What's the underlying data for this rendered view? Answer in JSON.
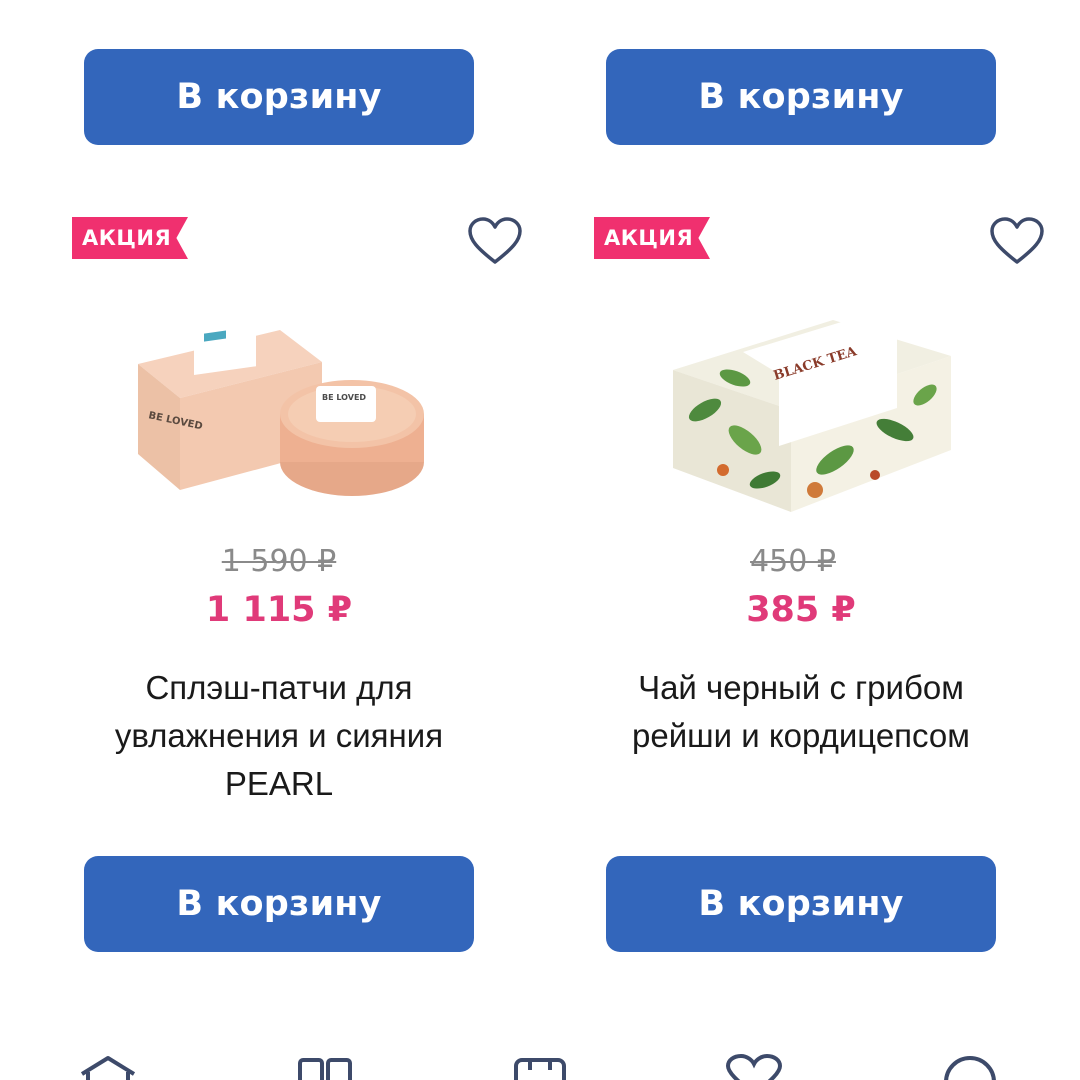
{
  "colors": {
    "button": "#3366bb",
    "badge": "#f0306f",
    "sale_price": "#e03a79",
    "icon_stroke": "#3d4a6a"
  },
  "top_row": {
    "left_button": "В корзину",
    "right_button": "В корзину"
  },
  "products": [
    {
      "badge": "АКЦИЯ",
      "image_label": "BE LOVED",
      "old_price": "1 590 ₽",
      "price": "1 115 ₽",
      "title_lines": [
        "Сплэш-патчи для",
        "увлажнения и сияния",
        "PEARL"
      ],
      "button": "В корзину",
      "favorite_icon": "heart-outline-icon"
    },
    {
      "badge": "АКЦИЯ",
      "image_label": "BLACK TEA",
      "old_price": "450 ₽",
      "price": "385 ₽",
      "title_lines": [
        "Чай черный с грибом",
        "рейши и кордицепсом"
      ],
      "button": "В корзину",
      "favorite_icon": "heart-outline-icon"
    }
  ],
  "tabbar": {
    "icons": [
      "home-icon",
      "catalog-icon",
      "cart-icon",
      "favorites-icon",
      "profile-icon"
    ]
  }
}
